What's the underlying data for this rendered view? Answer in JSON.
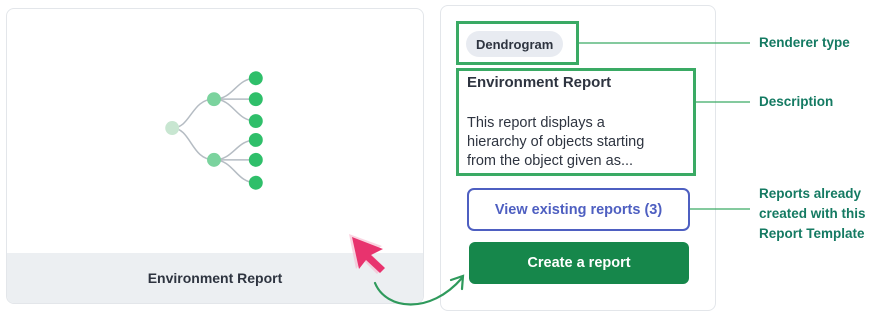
{
  "thumbnail": {
    "title": "Environment Report"
  },
  "details": {
    "renderer_badge": "Dendrogram",
    "title": "Environment Report",
    "description_line1": "This report displays a",
    "description_line2": "hierarchy of objects starting",
    "description_line3": "from the object given as..."
  },
  "actions": {
    "view_label": "View existing reports (3)",
    "create_label": "Create a report"
  },
  "callouts": {
    "renderer_type": "Renderer type",
    "description": "Description",
    "reports_line1": "Reports already",
    "reports_line2": "created with this",
    "reports_line3": "Report Template"
  },
  "colors": {
    "highlight": "#3aaa64",
    "accent_green": "#16874b",
    "outline_blue": "#4e5fc1",
    "callout_text": "#147a62",
    "cursor_pink": "#e8336e"
  },
  "icons": {
    "preview": "dendrogram-icon",
    "pointer": "cursor-arrow-icon",
    "connector": "curved-arrow-icon"
  }
}
